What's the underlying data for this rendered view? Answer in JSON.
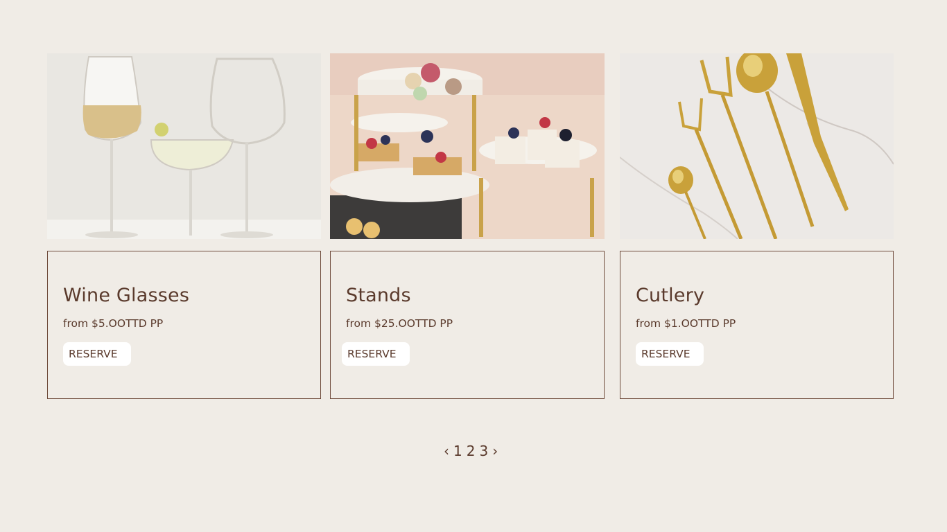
{
  "products": [
    {
      "name": "Wine Glasses",
      "price": "from $5.OOTTD PP",
      "button": "RESERVE",
      "image": "wine-glasses-photo"
    },
    {
      "name": "Stands",
      "price": "from $25.OOTTD PP",
      "button": "RESERVE",
      "image": "dessert-stands-photo"
    },
    {
      "name": "Cutlery",
      "price": "from $1.OOTTD PP",
      "button": "RESERVE",
      "image": "gold-cutlery-photo"
    }
  ],
  "pagination": {
    "prev": "‹",
    "pages": [
      "1",
      "2",
      "3"
    ],
    "next": "›"
  },
  "colors": {
    "background": "#f0ece6",
    "text": "#5a3a2c",
    "border": "#6e4a3a",
    "button_bg": "#ffffff"
  }
}
